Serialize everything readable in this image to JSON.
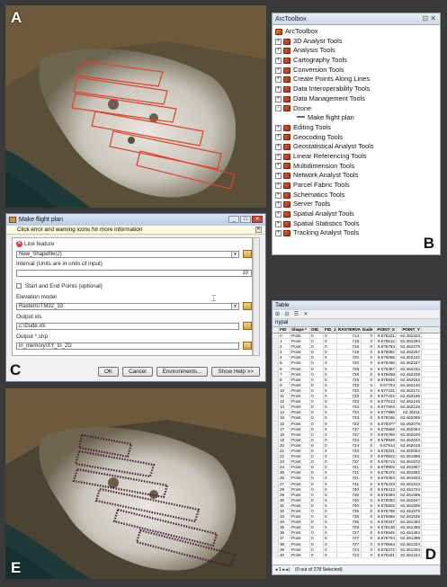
{
  "labels": {
    "a": "A",
    "b": "B",
    "c": "C",
    "d": "D",
    "e": "E"
  },
  "colors": {
    "panel_bg": "#3a3a3a",
    "red_polygon": "#e0412a",
    "purple_path": "#4a1a3a",
    "toolbox_icon": "#d0461f"
  },
  "toolbox": {
    "title": "ArcToolbox",
    "root": "ArcToolbox",
    "items": [
      {
        "label": "3D Analyst Tools",
        "expander": "+"
      },
      {
        "label": "Analysis Tools",
        "expander": "+"
      },
      {
        "label": "Cartography Tools",
        "expander": "+"
      },
      {
        "label": "Conversion Tools",
        "expander": "+"
      },
      {
        "label": "Create Points Along Lines",
        "expander": "+"
      },
      {
        "label": "Data Interoperability Tools",
        "expander": "+"
      },
      {
        "label": "Data Management Tools",
        "expander": "+"
      },
      {
        "label": "Drone",
        "expander": "−"
      }
    ],
    "drone_tool": "Make flight plan",
    "items_after": [
      {
        "label": "Editing Tools",
        "expander": "+"
      },
      {
        "label": "Geocoding Tools",
        "expander": "+"
      },
      {
        "label": "Geostatistical Analyst Tools",
        "expander": "+"
      },
      {
        "label": "Linear Referencing Tools",
        "expander": "+"
      },
      {
        "label": "Multidimension Tools",
        "expander": "+"
      },
      {
        "label": "Network Analyst Tools",
        "expander": "+"
      },
      {
        "label": "Parcel Fabric Tools",
        "expander": "+"
      },
      {
        "label": "Schematics Tools",
        "expander": "+"
      },
      {
        "label": "Server Tools",
        "expander": "+"
      },
      {
        "label": "Spatial Analyst Tools",
        "expander": "+"
      },
      {
        "label": "Spatial Statistics Tools",
        "expander": "+"
      },
      {
        "label": "Tracking Analyst Tools",
        "expander": "+"
      }
    ]
  },
  "dialog": {
    "title": "Make flight plan",
    "info": "Click error and warning icons for more information",
    "line_feature_label": "Line feature",
    "line_feature_value": "New_Shapefile(2)",
    "interval_label": "Interval (Units are in units of input)",
    "interval_value": "10",
    "start_end_label": "Start and End Points (optional)",
    "elevation_label": "Elevation model",
    "elevation_value": "Raster\\UTM32_33",
    "output_xls_label": "Output xls",
    "output_xls_value": "c:\\Dude.xls",
    "output_shp_label": "Output *.shp",
    "output_shp_value": "in_memory\\XY_to_2D",
    "buttons": {
      "ok": "OK",
      "cancel": "Cancel",
      "environments": "Environments...",
      "show_help": "Show Help >>"
    }
  },
  "table": {
    "title": "Table",
    "name": "nypal",
    "toolbar": "⊞ · ⊟ · ☰ · ✕",
    "columns": [
      "FID",
      "Shape *",
      "OID_",
      "FID_1",
      "RASTERVALU",
      "Dude",
      "POINT_X",
      "POINT_Y"
    ],
    "rows": [
      [
        "0",
        "Point",
        "0",
        "0",
        "714",
        "0",
        "9.575221",
        "62.462323"
      ],
      [
        "1",
        "Point",
        "0",
        "0",
        "719",
        "0",
        "9.575512",
        "62.462293"
      ],
      [
        "2",
        "Point",
        "0",
        "0",
        "719",
        "0",
        "9.575793",
        "62.462275"
      ],
      [
        "3",
        "Point",
        "0",
        "0",
        "719",
        "0",
        "9.575084",
        "62.462257"
      ],
      [
        "4",
        "Point",
        "0",
        "0",
        "720",
        "0",
        "9.576066",
        "62.462242"
      ],
      [
        "5",
        "Point",
        "0",
        "0",
        "720",
        "0",
        "9.576256",
        "62.462247"
      ],
      [
        "6",
        "Point",
        "0",
        "0",
        "726",
        "0",
        "9.576467",
        "62.462232"
      ],
      [
        "7",
        "Point",
        "0",
        "0",
        "728",
        "0",
        "9.576658",
        "62.462208"
      ],
      [
        "8",
        "Point",
        "0",
        "0",
        "728",
        "0",
        "9.576849",
        "62.462183"
      ],
      [
        "9",
        "Point",
        "0",
        "0",
        "732",
        "0",
        "9.57704",
        "62.462146"
      ],
      [
        "10",
        "Point",
        "0",
        "0",
        "733",
        "0",
        "9.577231",
        "62.462171"
      ],
      [
        "11",
        "Point",
        "0",
        "0",
        "733",
        "0",
        "9.577422",
        "62.462165"
      ],
      [
        "12",
        "Point",
        "0",
        "0",
        "733",
        "0",
        "9.577613",
        "62.462146"
      ],
      [
        "13",
        "Point",
        "0",
        "0",
        "734",
        "0",
        "9.577804",
        "62.462125"
      ],
      [
        "14",
        "Point",
        "0",
        "0",
        "734",
        "0",
        "9.577995",
        "62.46211"
      ],
      [
        "15",
        "Point",
        "0",
        "0",
        "733",
        "0",
        "9.578186",
        "62.462089"
      ],
      [
        "16",
        "Point",
        "0",
        "0",
        "733",
        "0",
        "9.578377",
        "62.462076"
      ],
      [
        "17",
        "Point",
        "0",
        "0",
        "737",
        "0",
        "9.578568",
        "62.462064"
      ],
      [
        "18",
        "Point",
        "0",
        "0",
        "737",
        "0",
        "9.578759",
        "62.462049"
      ],
      [
        "19",
        "Point",
        "0",
        "0",
        "734",
        "0",
        "9.578949",
        "62.462033"
      ],
      [
        "20",
        "Point",
        "0",
        "0",
        "734",
        "0",
        "9.57914",
        "62.462018"
      ],
      [
        "21",
        "Point",
        "0",
        "0",
        "734",
        "0",
        "9.579331",
        "62.462003"
      ],
      [
        "22",
        "Point",
        "0",
        "0",
        "734",
        "0",
        "9.579522",
        "62.461988"
      ],
      [
        "23",
        "Point",
        "0",
        "0",
        "737",
        "0",
        "9.579713",
        "62.461972"
      ],
      [
        "24",
        "Point",
        "0",
        "0",
        "741",
        "0",
        "9.579904",
        "62.461957"
      ],
      [
        "25",
        "Point",
        "0",
        "0",
        "741",
        "0",
        "9.576472",
        "62.461882"
      ],
      [
        "26",
        "Point",
        "0",
        "0",
        "741",
        "0",
        "9.576453",
        "62.461843"
      ],
      [
        "27",
        "Point",
        "0",
        "0",
        "741",
        "0",
        "9.576433",
        "62.461813"
      ],
      [
        "28",
        "Point",
        "0",
        "0",
        "740",
        "0",
        "9.576413",
        "62.461724"
      ],
      [
        "29",
        "Point",
        "0",
        "0",
        "740",
        "0",
        "9.576393",
        "62.461699"
      ],
      [
        "30",
        "Point",
        "0",
        "0",
        "740",
        "0",
        "9.576062",
        "62.461647"
      ],
      [
        "31",
        "Point",
        "0",
        "0",
        "740",
        "0",
        "9.575902",
        "62.461606"
      ],
      [
        "32",
        "Point",
        "0",
        "0",
        "735",
        "0",
        "9.575798",
        "62.461575"
      ],
      [
        "33",
        "Point",
        "0",
        "0",
        "735",
        "0",
        "9.575686",
        "62.461535"
      ],
      [
        "34",
        "Point",
        "0",
        "0",
        "735",
        "0",
        "9.576327",
        "62.461493"
      ],
      [
        "35",
        "Point",
        "0",
        "0",
        "728",
        "0",
        "9.576136",
        "62.461468"
      ],
      [
        "36",
        "Point",
        "0",
        "0",
        "727",
        "0",
        "9.575945",
        "62.461464"
      ],
      [
        "37",
        "Point",
        "0",
        "0",
        "727",
        "0",
        "9.575754",
        "62.461398"
      ],
      [
        "38",
        "Point",
        "0",
        "0",
        "727",
        "0",
        "9.575563",
        "62.461334"
      ],
      [
        "39",
        "Point",
        "0",
        "0",
        "724",
        "0",
        "9.575372",
        "62.461304"
      ],
      [
        "40",
        "Point",
        "0",
        "0",
        "723",
        "0",
        "9.575181",
        "62.461244"
      ]
    ],
    "nav": "◂  1  ▸ ▸|",
    "status": "(0 out of 278 Selected)",
    "tab": "nypal"
  }
}
